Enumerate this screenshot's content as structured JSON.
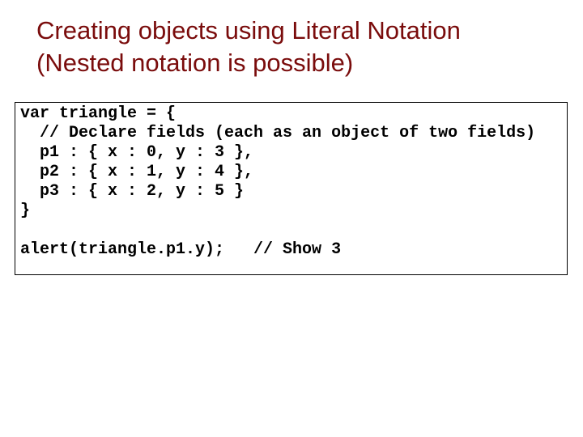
{
  "slide": {
    "title_lines": [
      "Creating objects using Literal Notation",
      "(Nested notation is possible)"
    ],
    "title_color": "#7a0c0c",
    "code_lines": [
      "var triangle = {",
      "  // Declare fields (each as an object of two fields)",
      "  p1 : { x : 0, y : 3 },",
      "  p2 : { x : 1, y : 4 },",
      "  p3 : { x : 2, y : 5 }",
      "}",
      "",
      "alert(triangle.p1.y);   // Show 3"
    ]
  }
}
